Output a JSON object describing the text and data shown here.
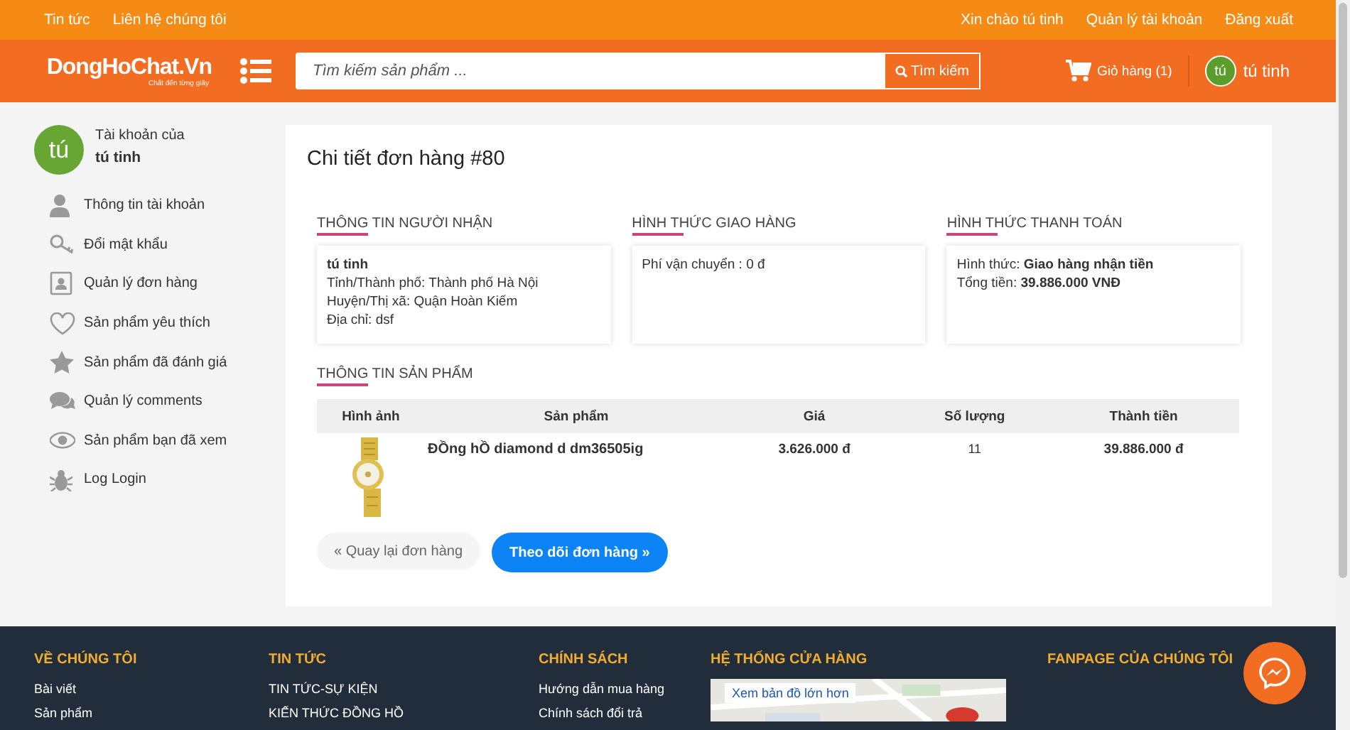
{
  "topbar": {
    "links": [
      "Tin tức",
      "Liên hệ chúng tôi"
    ],
    "user_links": [
      "Xin chào tú tinh",
      "Quản lý tài khoản",
      "Đăng xuất"
    ]
  },
  "header": {
    "logo": "DongHoChat.Vn",
    "slogan": "Chất đến từng giây",
    "search": {
      "placeholder": "Tìm kiếm sản phẩm ..."
    },
    "search_button": "Tìm kiếm",
    "cart": "Giỏ hàng (1)",
    "avatar": "tú",
    "user": "tú tinh"
  },
  "sidebar": {
    "avatar": "tú",
    "caption": "Tài khoản của",
    "name": "tú tinh",
    "items": [
      {
        "label": "Thông tin tài khoản"
      },
      {
        "label": "Đổi mật khẩu"
      },
      {
        "label": "Quản lý đơn hàng"
      },
      {
        "label": "Sản phẩm yêu thích"
      },
      {
        "label": "Sản phẩm đã đánh giá"
      },
      {
        "label": "Quản lý comments"
      },
      {
        "label": "Sản phẩm bạn đã xem"
      },
      {
        "label": "Log Login"
      }
    ]
  },
  "order": {
    "title": "Chi tiết đơn hàng #80",
    "sections": [
      {
        "heading": "THÔNG TIN NGƯỜI NHẬN",
        "lines": [
          "**tú tinh**",
          "Tỉnh/Thành phố: Thành phố Hà Nội",
          "Huyện/Thị xã: Quận Hoàn Kiếm",
          "Địa chỉ: dsf"
        ]
      },
      {
        "heading": "HÌNH THỨC GIAO HÀNG",
        "lines": [
          "Phí vận chuyển : 0 đ"
        ]
      },
      {
        "heading": "HÌNH THỨC THANH TOÁN",
        "lines": [
          "Hình thức: **Giao hàng nhận tiền**",
          "Tổng tiền: **39.886.000 VNĐ**"
        ]
      }
    ],
    "products_heading": "THÔNG TIN SẢN PHẨM",
    "table": {
      "columns": [
        "Hình ảnh",
        "Sản phẩm",
        "Giá",
        "Số lượng",
        "Thành tiền"
      ],
      "rows": [
        {
          "product": "ĐỒng hỒ diamond d dm36505ig",
          "price": "3.626.000 đ",
          "quantity": "11",
          "total": "39.886.000 đ"
        }
      ]
    },
    "back_button": "« Quay lại đơn hàng",
    "track_button": "Theo dõi đơn hàng »"
  },
  "footer": {
    "columns": [
      {
        "heading": "VỀ CHÚNG TÔI",
        "links": [
          "Bài viết",
          "Sản phẩm"
        ]
      },
      {
        "heading": "TIN TỨC",
        "links": [
          "TIN TỨC-SỰ KIỆN",
          "KIẾN THỨC ĐỒNG HỒ"
        ]
      },
      {
        "heading": "CHÍNH SÁCH",
        "links": [
          "Hướng dẫn mua hàng",
          "Chính sách đổi trả"
        ]
      },
      {
        "heading": "HỆ THỐNG CỬA HÀNG",
        "map_link": "Xem bản đồ lớn hơn"
      },
      {
        "heading": "FANPAGE CỦA CHÚNG TÔI"
      }
    ]
  }
}
